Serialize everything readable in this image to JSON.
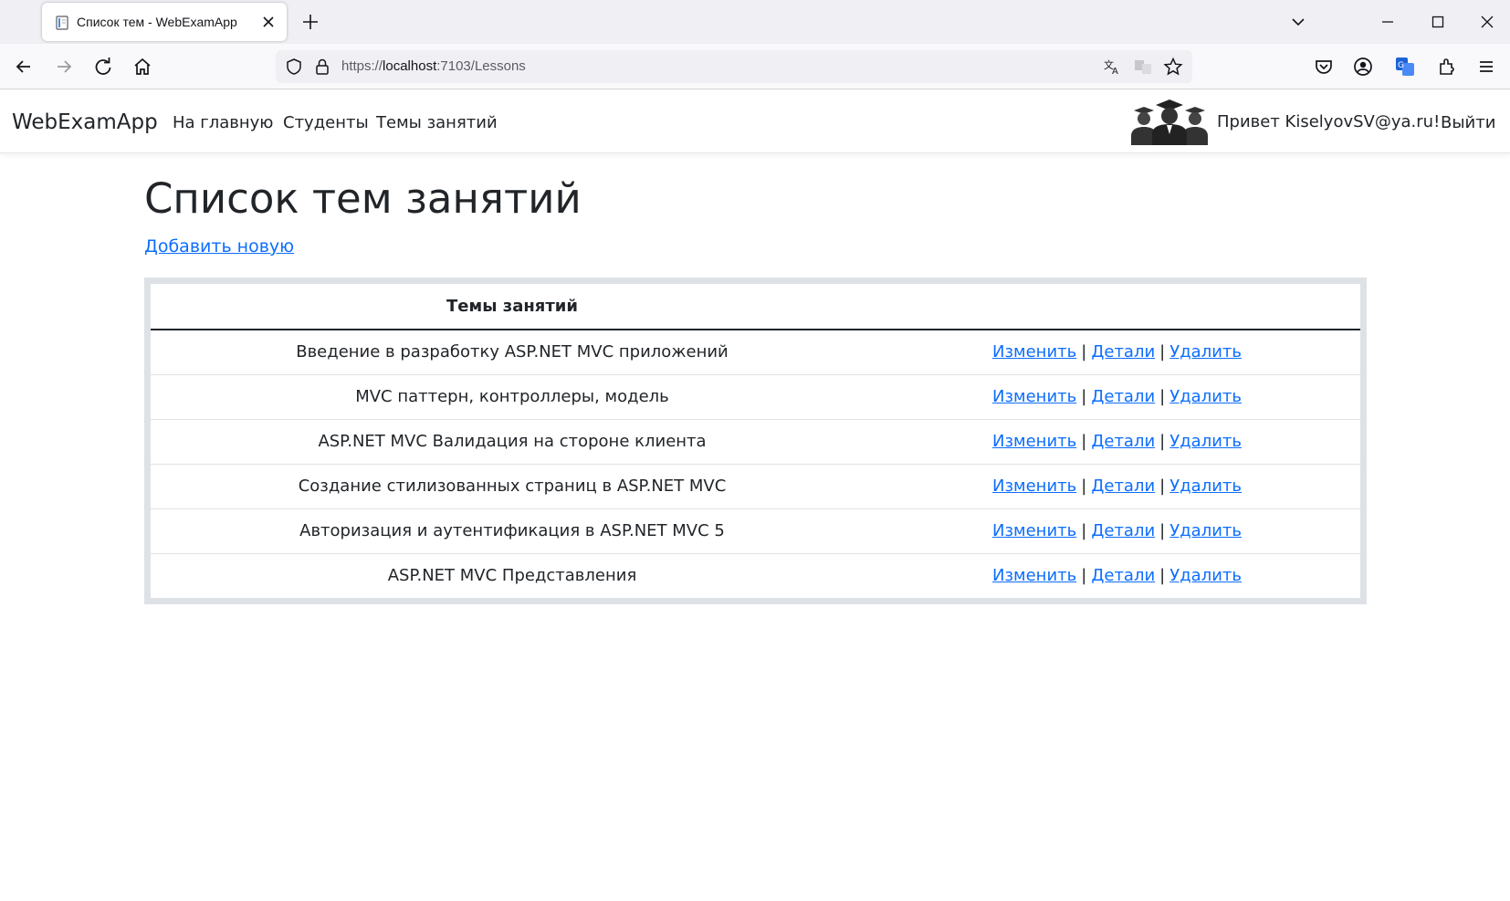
{
  "browser": {
    "tab_title": "Список тем - WebExamApp",
    "url_prefix": "https://",
    "url_host": "localhost",
    "url_rest": ":7103/Lessons",
    "colors": {
      "tabstrip": "#f0f0f4",
      "toolbar": "#f9f9fb"
    }
  },
  "app": {
    "brand": "WebExamApp",
    "nav": {
      "home": "На главную",
      "students": "Студенты",
      "lessons": "Темы занятий"
    },
    "greeting": "Привет KiselyovSV@ya.ru!",
    "logout": "Выйти"
  },
  "main": {
    "title": "Список тем занятий",
    "add_link": "Добавить новую",
    "table": {
      "header_topic": "Темы занятий",
      "header_actions": "",
      "rows": [
        {
          "topic": "Введение в разработку ASP.NET MVC приложений"
        },
        {
          "topic": "MVC паттерн, контроллеры, модель"
        },
        {
          "topic": "ASP.NET MVC Валидация на стороне клиента"
        },
        {
          "topic": "Создание стилизованных страниц в ASP.NET MVC"
        },
        {
          "topic": "Авторизация и аутентификация в ASP.NET MVC 5"
        },
        {
          "topic": "ASP.NET MVC Представления"
        }
      ],
      "actions": {
        "edit": "Изменить",
        "details": "Детали",
        "delete": "Удалить",
        "separator": "|"
      }
    },
    "colors": {
      "link": "#0d6efd",
      "table_border": "#dee2e6"
    }
  }
}
